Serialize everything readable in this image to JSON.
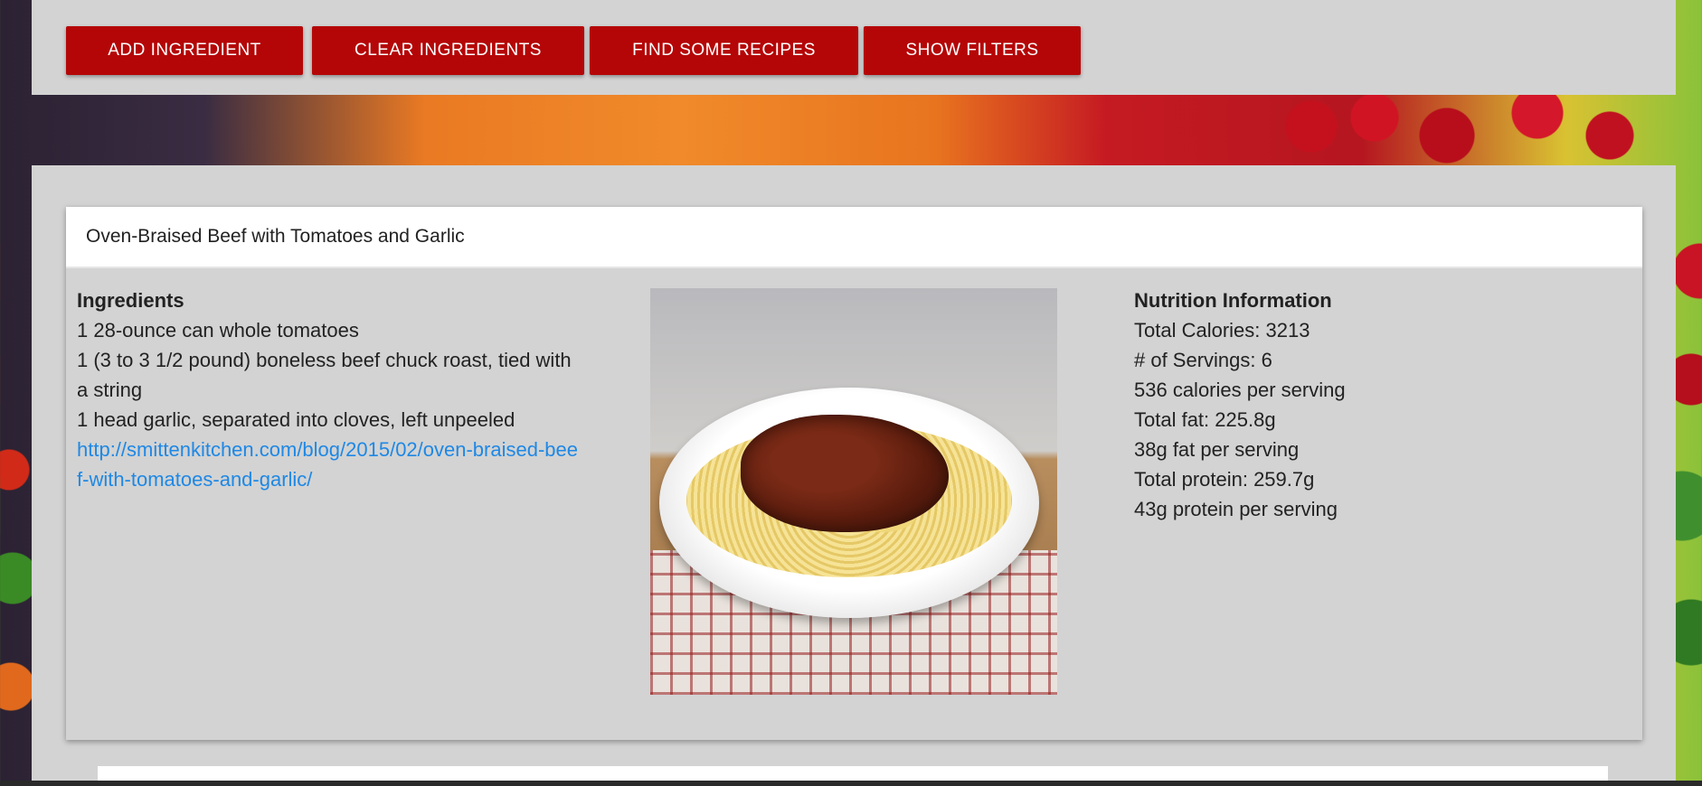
{
  "toolbar": {
    "add_ingredient": "ADD INGREDIENT",
    "clear_ingredients": "CLEAR INGREDIENTS",
    "find_recipes": "FIND SOME RECIPES",
    "show_filters": "SHOW FILTERS"
  },
  "recipe": {
    "title": "Oven-Braised Beef with Tomatoes and Garlic",
    "ingredients_heading": "Ingredients",
    "ingredients": [
      "1 28-ounce can whole tomatoes",
      "1 (3 to 3 1/2 pound) boneless beef chuck roast, tied with a string",
      "1 head garlic, separated into cloves, left unpeeled"
    ],
    "link": "http://smittenkitchen.com/blog/2015/02/oven-braised-beef-with-tomatoes-and-garlic/",
    "nutrition_heading": "Nutrition Information",
    "nutrition": [
      "Total Calories: 3213",
      "# of Servings: 6",
      "536 calories per serving",
      "Total fat: 225.8g",
      "38g fat per serving",
      "Total protein: 259.7g",
      "43g protein per serving"
    ]
  },
  "colors": {
    "button": "#b50607",
    "panel": "#d3d3d3",
    "link": "#1e88e5"
  }
}
